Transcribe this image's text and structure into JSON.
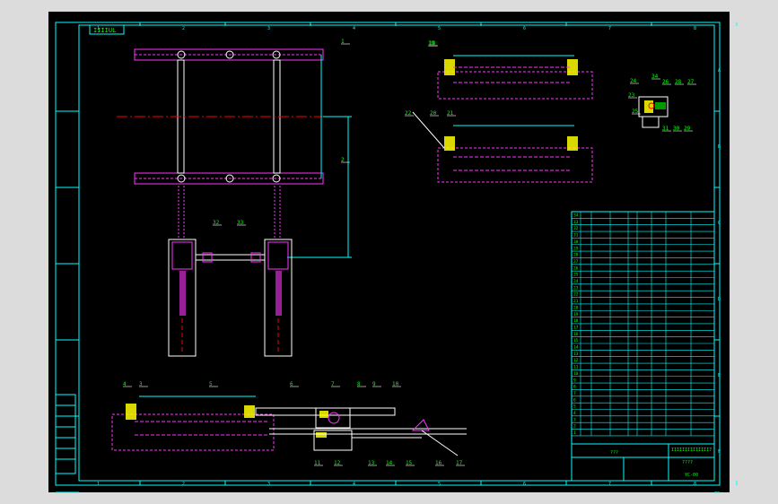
{
  "title_tag": "IIIIUL",
  "part_numbers": [
    "1",
    "2",
    "3",
    "4",
    "5",
    "6",
    "7",
    "8",
    "9",
    "10",
    "11",
    "12",
    "13",
    "14",
    "15",
    "16",
    "17",
    "18",
    "19",
    "20",
    "21",
    "22",
    "23",
    "24",
    "25",
    "26",
    "27",
    "28",
    "29",
    "30",
    "31",
    "32",
    "33",
    "34"
  ],
  "border_grid": {
    "top": [
      "1",
      "2",
      "3",
      "4",
      "5",
      "6",
      "7",
      "8"
    ],
    "side": [
      "A",
      "B",
      "C",
      "D",
      "E",
      "F"
    ]
  },
  "title_block": {
    "label_a": "???",
    "label_b": "????",
    "drawing_no": "YC-00",
    "code": "IIIIIIIIIIIIII7"
  },
  "colors": {
    "background": "#000000",
    "frame": "#00ffff",
    "part": "#ff33ff",
    "outline": "#ffffff",
    "center": "#ff0000",
    "highlight": "#ffff00",
    "text": "#00ff00"
  }
}
